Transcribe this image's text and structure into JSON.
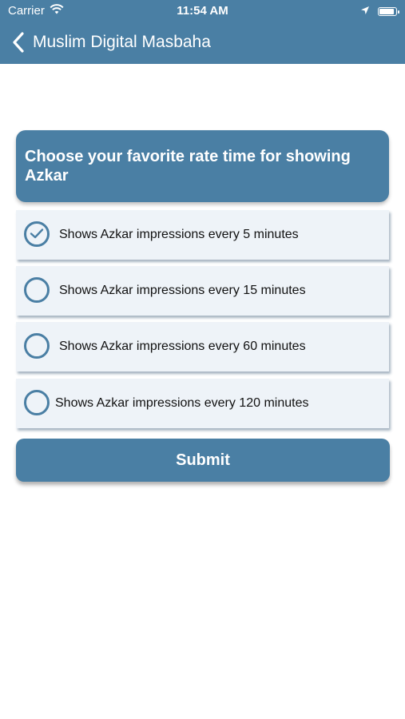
{
  "status_bar": {
    "carrier": "Carrier",
    "time": "11:54 AM"
  },
  "nav": {
    "title": "Muslim Digital Masbaha"
  },
  "question": "Choose your favorite rate time for showing Azkar",
  "options": [
    {
      "label": "Shows Azkar impressions every 5 minutes",
      "selected": true
    },
    {
      "label": "Shows Azkar impressions every 15 minutes",
      "selected": false
    },
    {
      "label": "Shows Azkar impressions every 60 minutes",
      "selected": false
    },
    {
      "label": "Shows Azkar impressions every 120 minutes",
      "selected": false
    }
  ],
  "submit_label": "Submit",
  "colors": {
    "primary": "#4a7fa4",
    "option_bg": "#eef3f8"
  }
}
